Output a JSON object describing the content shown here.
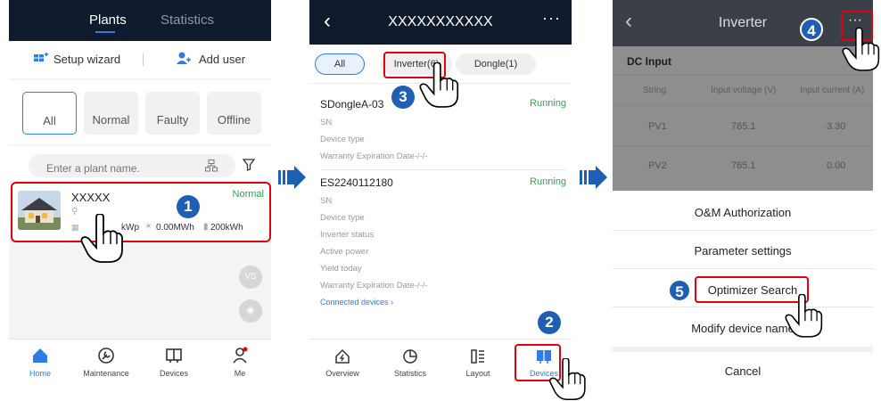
{
  "panel1": {
    "tabs": [
      "Plants",
      "Statistics"
    ],
    "actions": [
      "Setup wizard",
      "Add user"
    ],
    "filters": [
      "All",
      "Normal",
      "Faulty",
      "Offline"
    ],
    "search_placeholder": "Enter a plant name.",
    "plant": {
      "name": "XXXXX",
      "status": "Normal",
      "capacity": "kWp",
      "energy": "0.00MWh",
      "storage": "200kWh"
    },
    "vs_label": "VS",
    "nav": [
      "Home",
      "Maintenance",
      "Devices",
      "Me"
    ]
  },
  "panel2": {
    "title": "XXXXXXXXXXX",
    "chips": [
      "All",
      "Inverter(6)",
      "Dongle(1)"
    ],
    "device1": {
      "name": "SDongleA-03",
      "status": "Running",
      "rows": [
        "SN",
        "Device type",
        "Warranty Expiration Date-/-/-"
      ]
    },
    "device2": {
      "name": "ES2240112180",
      "status": "Running",
      "rows": [
        "SN",
        "Device type",
        "Inverter status",
        "Active power",
        "Yield today",
        "Warranty Expiration Date-/-/-"
      ],
      "link": "Connected devices"
    },
    "nav": [
      "Overview",
      "Statistics",
      "Layout",
      "Devices"
    ]
  },
  "panel3": {
    "title": "Inverter",
    "section": "DC Input",
    "headers": [
      "String",
      "Input voltage (V)",
      "Input current (A)"
    ],
    "rows": [
      [
        "PV1",
        "765.1",
        "3.30"
      ],
      [
        "PV2",
        "765.1",
        "0.00"
      ]
    ],
    "menu": [
      "O&M Authorization",
      "Parameter settings",
      "Optimizer Search",
      "Modify device name",
      "Cancel"
    ]
  },
  "steps": [
    "1",
    "2",
    "3",
    "4",
    "5"
  ],
  "colors": {
    "accent": "#2f7be8",
    "highlight": "#e3000f",
    "running": "#2aa84a",
    "header": "#0f1b2d"
  }
}
